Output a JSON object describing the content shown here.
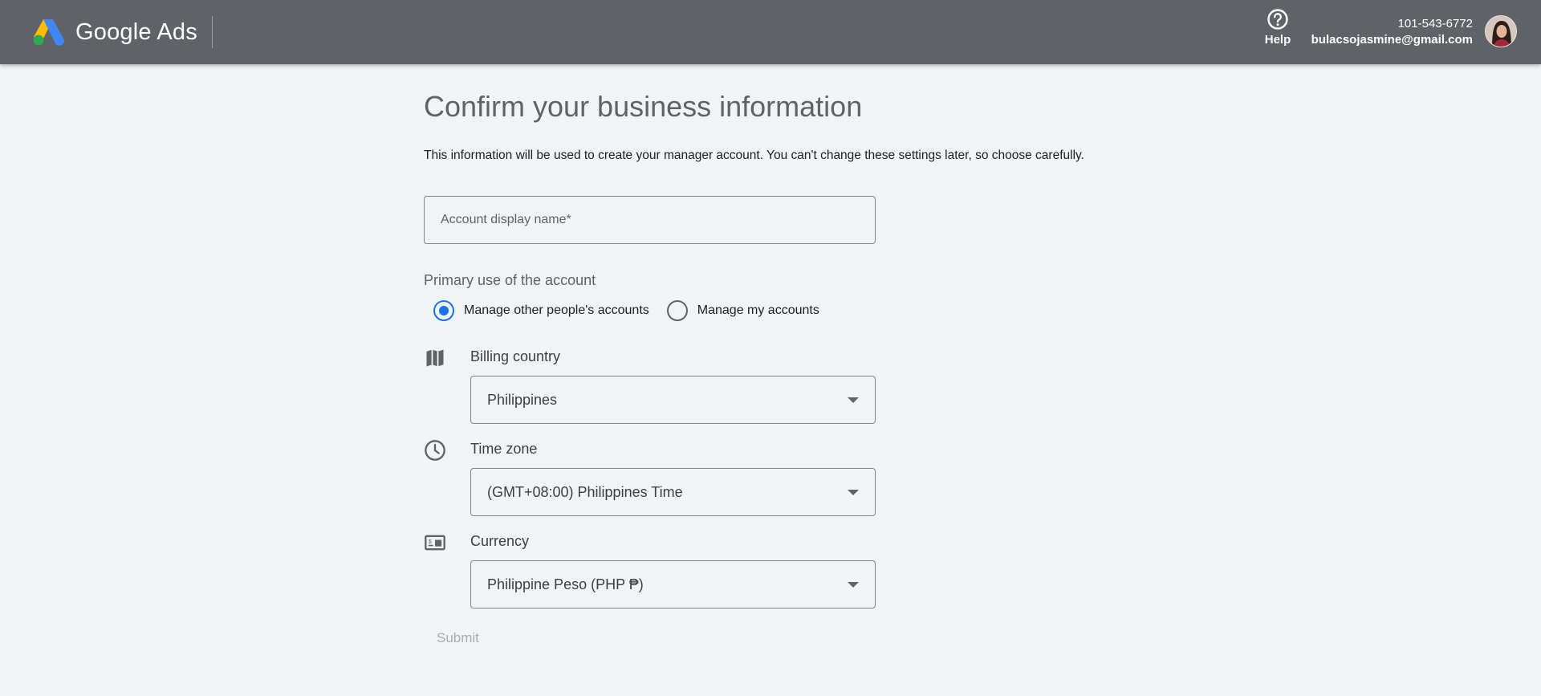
{
  "header": {
    "brand": "Google Ads",
    "help_label": "Help",
    "account_id": "101-543-6772",
    "account_email": "bulacsojasmine@gmail.com"
  },
  "main": {
    "title": "Confirm your business information",
    "description": "This information will be used to create your manager account. You can't change these settings later, so choose carefully.",
    "display_name_field": {
      "value": "",
      "placeholder": "Account display name*"
    },
    "primary_use": {
      "label": "Primary use of the account",
      "options": [
        {
          "label": "Manage other people's accounts",
          "selected": true
        },
        {
          "label": "Manage my accounts",
          "selected": false
        }
      ]
    },
    "billing_country": {
      "label": "Billing country",
      "value": "Philippines",
      "icon": "map-icon"
    },
    "time_zone": {
      "label": "Time zone",
      "value": "(GMT+08:00) Philippines Time",
      "icon": "clock-icon"
    },
    "currency": {
      "label": "Currency",
      "value": "Philippine Peso (PHP ₱)",
      "icon": "currency-card-icon"
    },
    "submit_label": "Submit"
  },
  "colors": {
    "header_bg": "#5f6368",
    "page_bg": "#f1f3f4",
    "accent": "#1a73e8",
    "disabled_text": "#a8abaf"
  }
}
